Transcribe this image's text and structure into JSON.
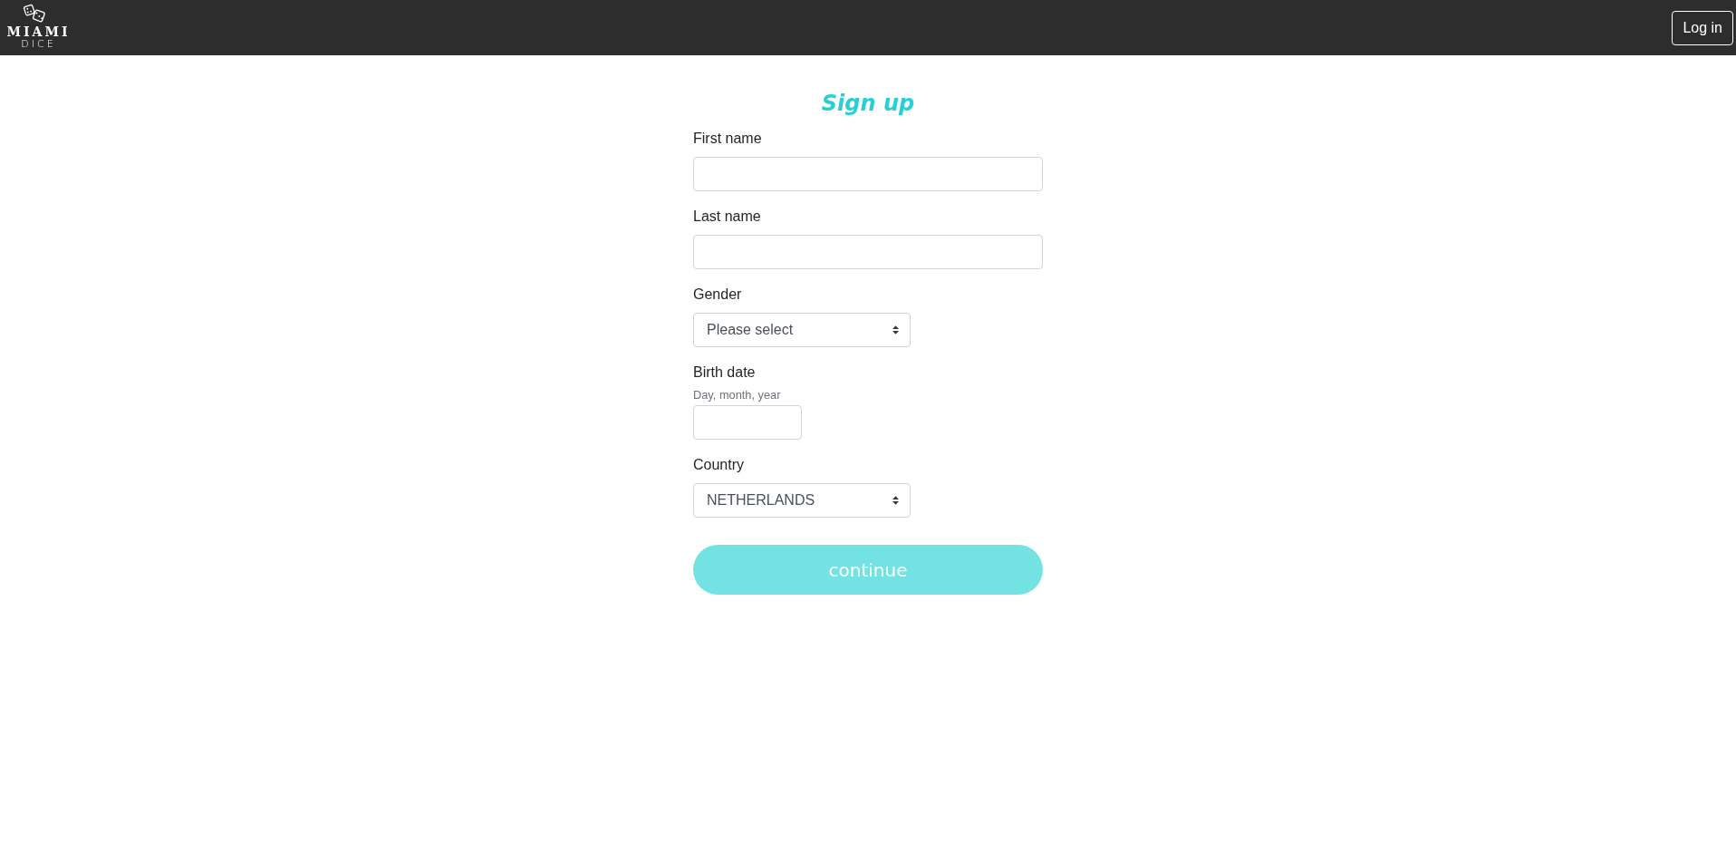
{
  "header": {
    "logo": {
      "line_1": "MIAMI",
      "line_2": "DICE"
    },
    "login_button": "Log in"
  },
  "form": {
    "title": "Sign up",
    "fields": [
      {
        "kind": "text",
        "label": "First name"
      },
      {
        "kind": "text",
        "label": "Last name"
      },
      {
        "kind": "select",
        "label": "Gender",
        "value": "Please select"
      },
      {
        "kind": "date",
        "label": "Birth date",
        "hint": "Day, month, year"
      },
      {
        "kind": "select",
        "label": "Country",
        "value": "NETHERLANDS"
      }
    ],
    "submit": "continue"
  }
}
